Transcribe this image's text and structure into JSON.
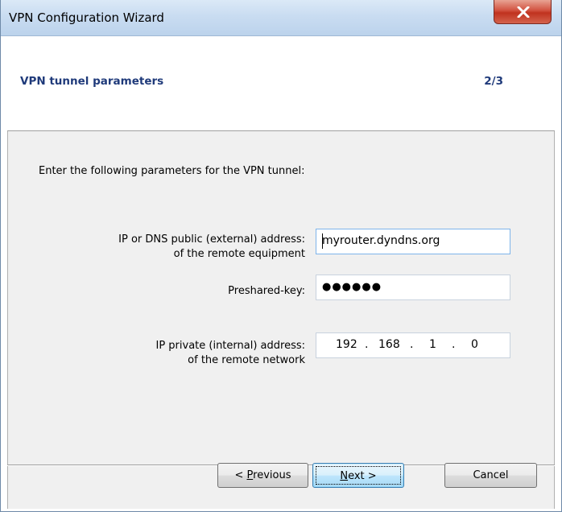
{
  "window": {
    "title": "VPN Configuration Wizard"
  },
  "header": {
    "title": "VPN tunnel parameters",
    "step": "2/3"
  },
  "intro": "Enter the following parameters for the VPN tunnel:",
  "fields": {
    "public_address": {
      "label_line1": "IP or DNS public (external) address:",
      "label_line2": "of the remote equipment",
      "value": "myrouter.dyndns.org"
    },
    "preshared_key": {
      "label": "Preshared-key:",
      "masked_value": "●●●●●●"
    },
    "private_address": {
      "label_line1": "IP private (internal) address:",
      "label_line2": "of the remote network",
      "octets": [
        "192",
        "168",
        "1",
        "0"
      ],
      "separator": "."
    }
  },
  "buttons": {
    "previous_prefix": "< ",
    "previous_mnemonic": "P",
    "previous_rest": "revious",
    "next_mnemonic": "N",
    "next_rest": "ext >",
    "cancel": "Cancel"
  },
  "colors": {
    "header_text": "#1f3a7a",
    "close_button": "#c0321f",
    "focus_border": "#7eb4ea"
  },
  "icons": {
    "close": "close-x-icon"
  }
}
